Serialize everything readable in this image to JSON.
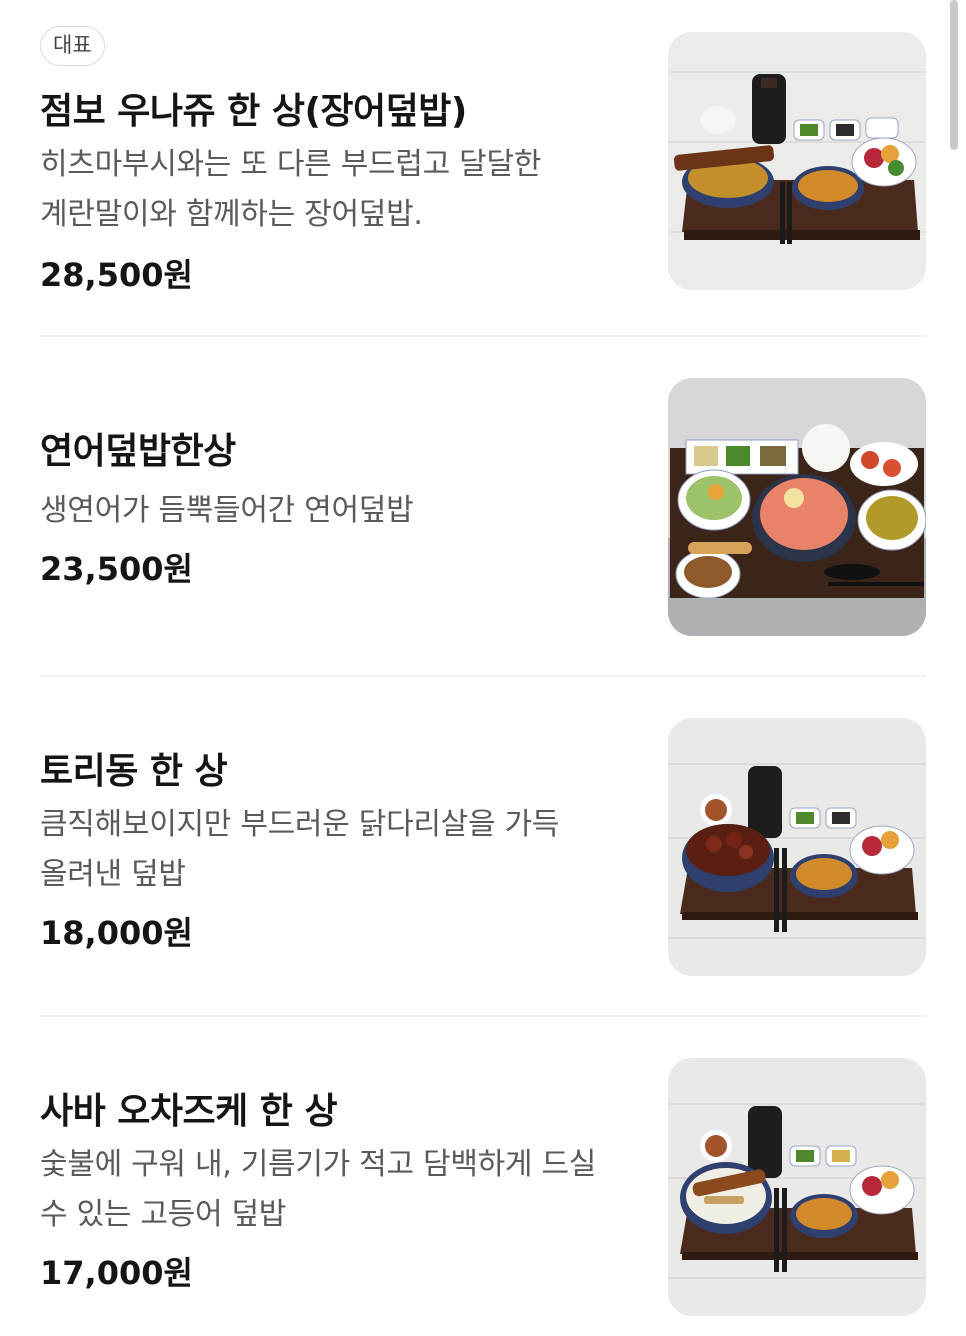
{
  "menu": {
    "items": [
      {
        "badge": "대표",
        "name": "점보 우나쥬 한 상(장어덮밥)",
        "description": "히츠마부시와는 또 다른 부드럽고 달달한 계란말이와 함께하는 장어덮밥.",
        "price": "28,500원",
        "image": "eel-rice-set-photo"
      },
      {
        "name": "연어덮밥한상",
        "description": "생연어가 듬뿍들어간 연어덮밥",
        "price": "23,500원",
        "image": "salmon-rice-set-photo"
      },
      {
        "name": "토리동 한 상",
        "description": "큼직해보이지만 부드러운 닭다리살을 가득 올려낸 덮밥",
        "price": "18,000원",
        "image": "chicken-rice-set-photo"
      },
      {
        "name": "사바 오차즈케 한 상",
        "description": "숯불에 구워 내, 기름기가 적고 담백하게 드실 수 있는 고등어 덮밥",
        "price": "17,000원",
        "image": "mackerel-rice-set-photo"
      }
    ]
  },
  "colors": {
    "text_primary": "#151515",
    "text_secondary": "#5a5a5a",
    "divider": "#f1f1f1",
    "badge_border": "#d9d9d9",
    "tray": "#4a2a1c"
  }
}
